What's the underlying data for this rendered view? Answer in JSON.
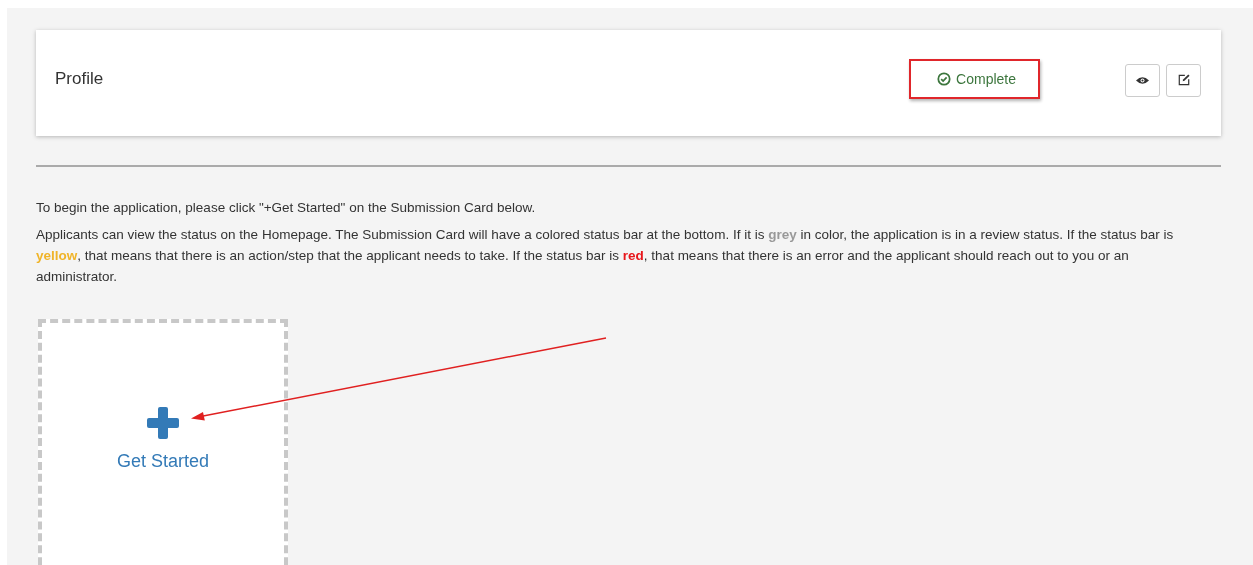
{
  "profile_card": {
    "title": "Profile",
    "status": "Complete",
    "status_highlighted": true
  },
  "intro": "To begin the application, please click \"+Get Started\" on the Submission Card below.",
  "status_help": [
    {
      "text": "Applicants can view the status on the Homepage. The Submission Card will have a colored status bar at the bottom. If it is "
    },
    {
      "text": "grey",
      "color": "#999999"
    },
    {
      "text": " in color, the application is in a review status. If the status bar is "
    },
    {
      "text": "yellow",
      "color": "#f0b429"
    },
    {
      "text": ", that means that there is an action/step that the applicant needs to take. If the status bar is "
    },
    {
      "text": "red",
      "color": "#e8161b"
    },
    {
      "text": ", that means that there is an error and the applicant should reach out to you or an administrator."
    }
  ],
  "submission_card": {
    "label": "Get Started"
  }
}
